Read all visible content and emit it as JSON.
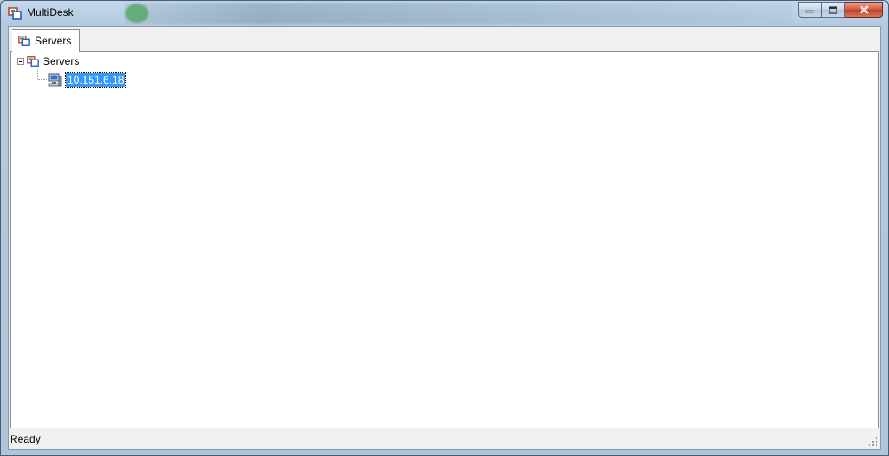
{
  "window": {
    "title": "MultiDesk",
    "app_icon": "multidesk-icon",
    "caption_buttons": [
      "minimize-icon",
      "maximize-icon",
      "close-icon"
    ]
  },
  "tabs": [
    {
      "label": "Servers",
      "icon": "servers-icon",
      "active": true
    }
  ],
  "tree": {
    "root": {
      "label": "Servers",
      "icon": "servers-icon",
      "expanded": true
    },
    "children": [
      {
        "label": "10.151.6.18",
        "icon": "computer-icon",
        "selected": true
      }
    ]
  },
  "statusbar": {
    "text": "Ready"
  },
  "colors": {
    "selection": "#3399ff",
    "window_frame": "#b3cade",
    "close_button": "#c33f22"
  }
}
